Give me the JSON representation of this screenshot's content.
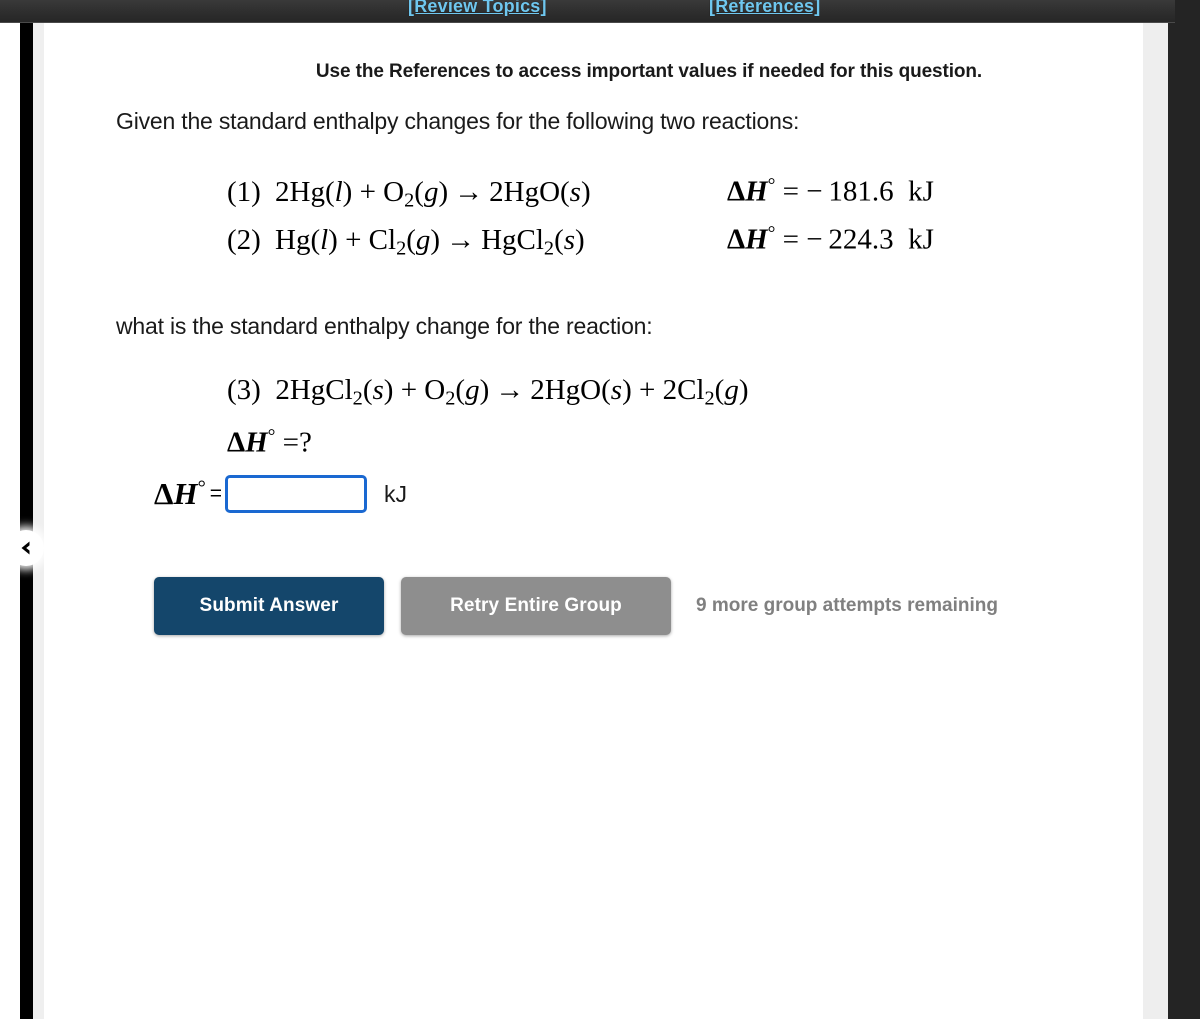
{
  "topbar": {
    "review_topics_label": "[Review Topics]",
    "references_label": "[References]"
  },
  "collapse_handle": {
    "icon": "chevron-left-icon"
  },
  "content": {
    "reference_note": "Use the References to access important values if needed for this question.",
    "prompt_given": "Given the standard enthalpy changes for the following two reactions:",
    "prompt_question": "what is the standard enthalpy change for the reaction:",
    "equations": [
      {
        "label": "(1)",
        "reactants": "2Hg(l) + O2(g)",
        "products": "2HgO(s)",
        "delta_h": "ΔH° = − 181.6 kJ",
        "delta_h_value": -181.6,
        "delta_h_unit": "kJ"
      },
      {
        "label": "(2)",
        "reactants": "Hg(l) + Cl2(g)",
        "products": "HgCl2(s)",
        "delta_h": "ΔH° = − 224.3 kJ",
        "delta_h_value": -224.3,
        "delta_h_unit": "kJ"
      }
    ],
    "target_equation": {
      "label": "(3)",
      "reactants": "2HgCl2(s) + O2(g)",
      "products": "2HgO(s) + 2Cl2(g)",
      "delta_h": "ΔH° =?"
    },
    "answer": {
      "label": "ΔH°",
      "equals": "=",
      "value": "",
      "placeholder": "",
      "unit": "kJ"
    },
    "actions": {
      "submit_label": "Submit Answer",
      "retry_label": "Retry Entire Group",
      "attempts_text": "9 more group attempts remaining"
    }
  },
  "colors": {
    "topbar_link": "#6fc7ef",
    "submit_button": "#14466b",
    "retry_button": "#8e8e8e",
    "input_border": "#1a68d1",
    "attempts_text": "#808080"
  }
}
